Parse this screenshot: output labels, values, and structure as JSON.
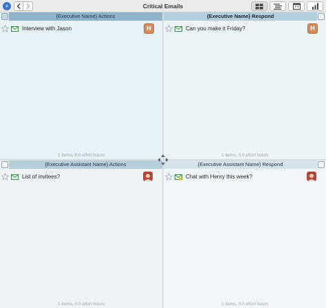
{
  "window": {
    "title": "Critical Emails"
  },
  "toolbar": {
    "circle_label": "+",
    "views": [
      "grid-view",
      "outline-view",
      "calendar-view",
      "chart-view"
    ]
  },
  "quadrants": [
    {
      "header": "{Executive Name} Actions",
      "footer": "1 items, 0.0 effort hours",
      "tasks": [
        {
          "title": "Interview with Jason",
          "avatar": "H"
        }
      ]
    },
    {
      "header": "{Executive Name} Respond",
      "footer": "1 items, 0.0 effort hours",
      "tasks": [
        {
          "title": "Can you make it Friday?",
          "avatar": "H"
        }
      ]
    },
    {
      "header": "{Executive Assistant Name} Actions",
      "footer": "1 items, 0.0 effort hours",
      "tasks": [
        {
          "title": "List of invitees?"
        }
      ]
    },
    {
      "header": "{Executive Assistant Name} Respond",
      "footer": "1 items, 0.0 effort hours",
      "tasks": [
        {
          "title": "Chat with Henry this week?"
        }
      ]
    }
  ],
  "colors": {
    "accent": "#3a73c9",
    "mail_icon": "#2e8b3a",
    "avatar_h": "#d88955"
  }
}
